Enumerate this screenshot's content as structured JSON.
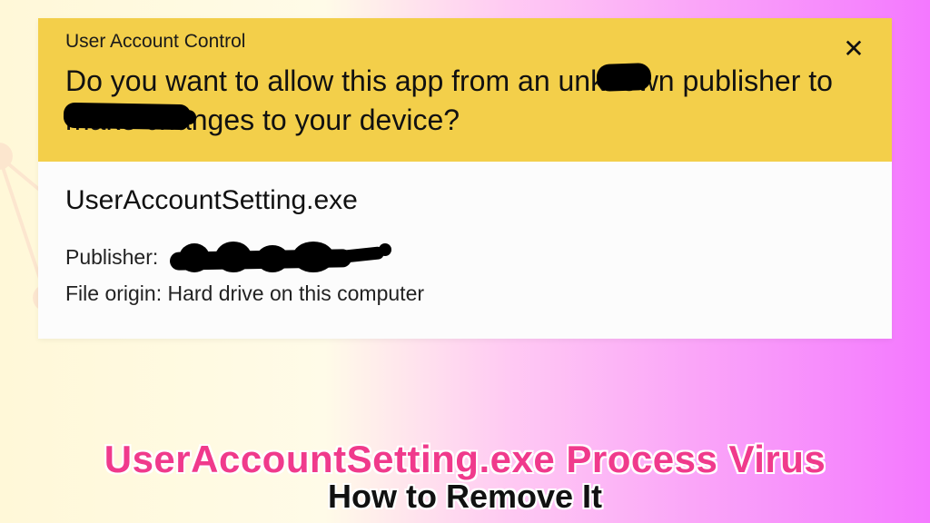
{
  "uac": {
    "title": "User Account Control",
    "question": "Do you want to allow this app from an unknown publisher to make changes to your device?",
    "close_label": "Close",
    "app_name": "UserAccountSetting.exe",
    "publisher_label": "Publisher:",
    "publisher_value": "[redacted]",
    "origin_label": "File origin:",
    "origin_value": "Hard drive on this computer"
  },
  "caption": {
    "line1": "UserAccountSetting.exe Process Virus",
    "line2": "How to Remove It"
  },
  "colors": {
    "uac_header_bg": "#f3cf4a",
    "accent_pink": "#f03a8c"
  }
}
